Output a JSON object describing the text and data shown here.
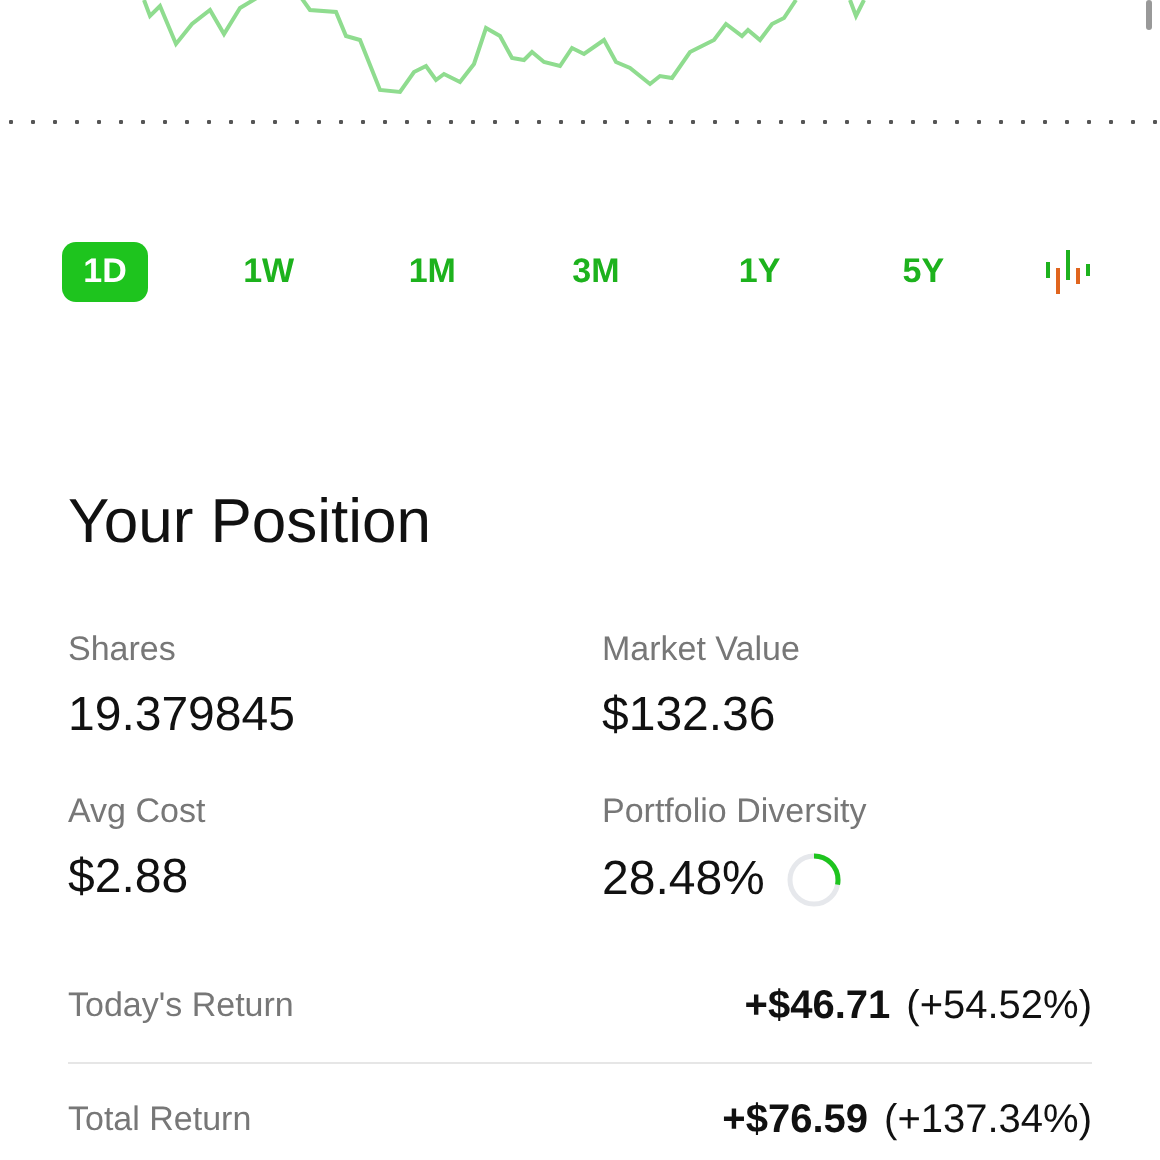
{
  "ranges": [
    {
      "label": "1D",
      "selected": true
    },
    {
      "label": "1W",
      "selected": false
    },
    {
      "label": "1M",
      "selected": false
    },
    {
      "label": "3M",
      "selected": false
    },
    {
      "label": "1Y",
      "selected": false
    },
    {
      "label": "5Y",
      "selected": false
    }
  ],
  "position": {
    "title": "Your Position",
    "stats": [
      {
        "label": "Shares",
        "value": "19.379845"
      },
      {
        "label": "Market Value",
        "value": "$132.36"
      },
      {
        "label": "Avg Cost",
        "value": "$2.88"
      },
      {
        "label": "Portfolio Diversity",
        "value": "28.48%",
        "kind": "ring",
        "level": 0.28
      }
    ],
    "returns": [
      {
        "label": "Today's Return",
        "amount": "+$46.71",
        "percent": "(+54.52%)"
      },
      {
        "label": "Total Return",
        "amount": "+$76.59",
        "percent": "(+137.34%)"
      }
    ]
  }
}
